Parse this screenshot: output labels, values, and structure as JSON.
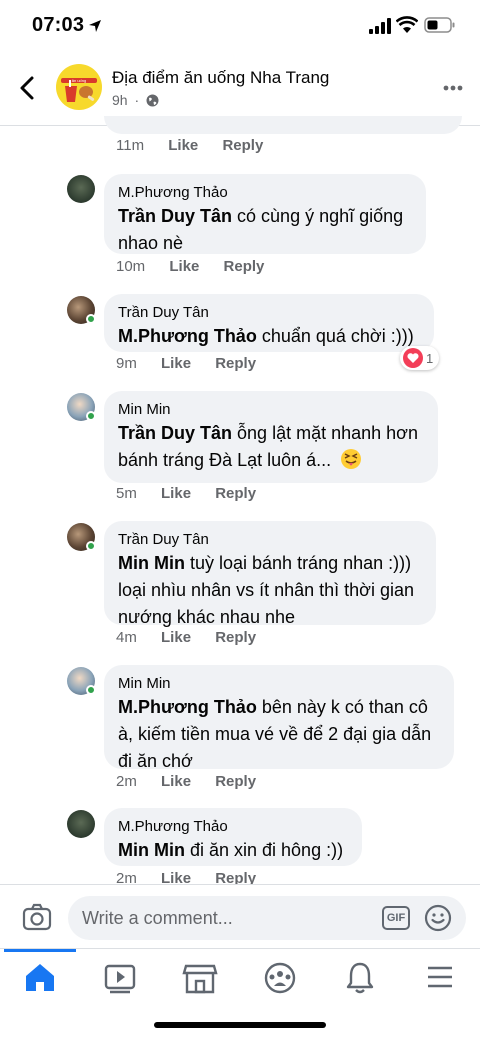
{
  "status": {
    "time": "07:03"
  },
  "header": {
    "title": "Địa điểm ăn uống Nha Trang",
    "time": "9h",
    "logo_text": "ăn uống"
  },
  "comments": [
    {
      "time": "11m",
      "like": "Like",
      "reply": "Reply"
    },
    {
      "author": "M.Phương Thảo",
      "mention": "Trần Duy Tân",
      "text": " có cùng ý nghĩ giống nhao nè",
      "time": "10m",
      "like": "Like",
      "reply": "Reply"
    },
    {
      "author": "Trần Duy Tân",
      "mention": "M.Phương Thảo",
      "text": " chuẩn quá chời :)))",
      "time": "9m",
      "like": "Like",
      "reply": "Reply",
      "reaction_count": "1"
    },
    {
      "author": "Min Min",
      "mention": "Trần Duy Tân",
      "text": " ỗng lật mặt nhanh hơn bánh tráng Đà Lạt luôn á...",
      "time": "5m",
      "like": "Like",
      "reply": "Reply"
    },
    {
      "author": "Trần Duy Tân",
      "mention": "Min Min",
      "text": " tuỳ loại bánh tráng nhan :))) loại nhìu nhân vs ít nhân thì thời gian nướng khác nhau nhe",
      "time": "4m",
      "like": "Like",
      "reply": "Reply"
    },
    {
      "author": "Min Min",
      "mention": "M.Phương Thảo",
      "text": " bên này k có than cô à, kiếm tiền mua vé về để 2 đại gia dẫn đi ăn chớ",
      "time": "2m",
      "like": "Like",
      "reply": "Reply"
    },
    {
      "author": "M.Phương Thảo",
      "mention": "Min Min",
      "text": " đi ăn xin đi hông :))",
      "time": "2m",
      "like": "Like",
      "reply": "Reply"
    }
  ],
  "composer": {
    "placeholder": "Write a comment...",
    "gif": "GIF"
  },
  "icons": [
    "camera-icon",
    "gif-icon",
    "emoji-icon",
    "home-icon",
    "video-icon",
    "marketplace-icon",
    "groups-icon",
    "bell-icon",
    "menu-icon"
  ],
  "colors": {
    "accent": "#1877f2",
    "bubble": "#f0f2f5",
    "muted": "#65676b",
    "online": "#31a24c"
  }
}
